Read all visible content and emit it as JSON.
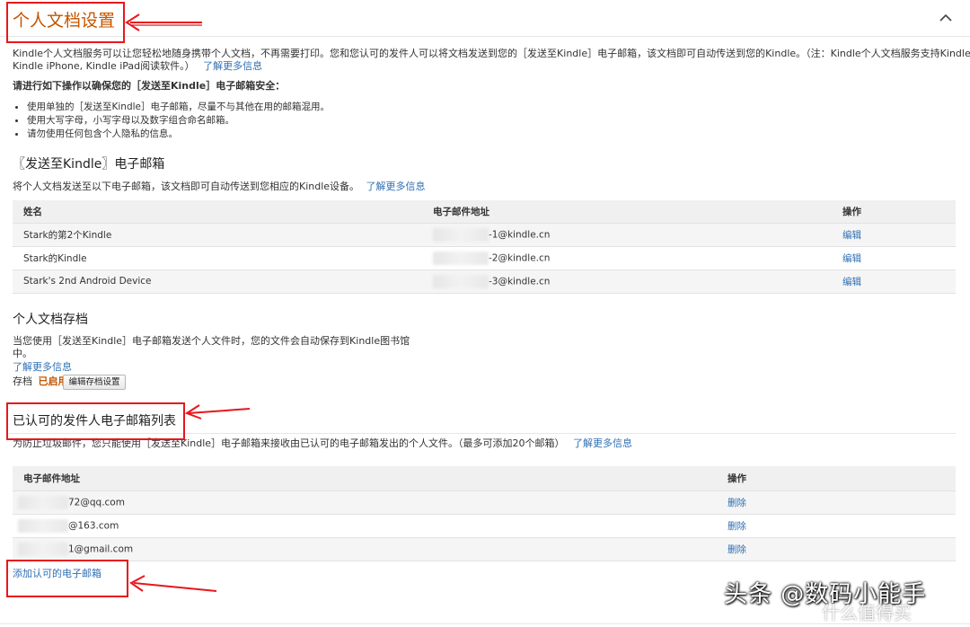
{
  "header": {
    "title": "个人文档设置",
    "collapse_icon": "chevron-up-icon"
  },
  "intro": {
    "line1": "Kindle个人文档服务可以让您轻松地随身携带个人文档，不再需要打印。您和您认可的发件人可以将文档发送到您的［发送至Kindle］电子邮箱，该文档即可自动传送到您的Kindle。（注：Kindle个人文档服务支持Kindle Android,",
    "line2": "Kindle iPhone, Kindle iPad阅读软件。）",
    "learn_more": "了解更多信息"
  },
  "security": {
    "heading": "请进行如下操作以确保您的［发送至Kindle］电子邮箱安全：",
    "tips": [
      "使用单独的［发送至Kindle］电子邮箱，尽量不与其他在用的邮箱混用。",
      "使用大写字母，小写字母以及数字组合命名邮箱。",
      "请勿使用任何包含个人隐私的信息。"
    ]
  },
  "send_to_kindle": {
    "title": "〖发送至Kindle〗电子邮箱",
    "desc": "将个人文档发送至以下电子邮箱，该文档即可自动传送到您相应的Kindle设备。",
    "learn_more": "了解更多信息",
    "columns": [
      "姓名",
      "电子邮件地址",
      "操作"
    ],
    "rows": [
      {
        "name": "Stark的第2个Kindle",
        "email": "-1@kindle.cn",
        "action": "编辑"
      },
      {
        "name": "Stark的Kindle",
        "email": "-2@kindle.cn",
        "action": "编辑"
      },
      {
        "name": "Stark's 2nd Android Device",
        "email": "-3@kindle.cn",
        "action": "编辑"
      }
    ]
  },
  "archive": {
    "title": "个人文档存档",
    "desc1": "当您使用［发送至Kindle］电子邮箱发送个人文件时，您的文件会自动保存到Kindle图书馆",
    "desc2": "中。",
    "learn_more": "了解更多信息",
    "label": "存档",
    "status": "已启用",
    "button": "编辑存档设置"
  },
  "approved": {
    "title": "已认可的发件人电子邮箱列表",
    "desc": "为防止垃圾邮件，您只能使用［发送至Kindle］电子邮箱来接收由已认可的电子邮箱发出的个人文件。（最多可添加20个邮箱）",
    "learn_more": "了解更多信息",
    "columns": [
      "电子邮件地址",
      "操作"
    ],
    "rows": [
      {
        "email": "72@qq.com",
        "action": "删除"
      },
      {
        "email": "@163.com",
        "action": "删除"
      },
      {
        "email": "1@gmail.com",
        "action": "删除"
      }
    ],
    "add_link": "添加认可的电子邮箱"
  },
  "watermark": {
    "text": "头条 @数码小能手",
    "faint": "什么值得买"
  },
  "colors": {
    "accent": "#c45500",
    "link": "#2f6fb3",
    "annotation_red": "#e8161c",
    "enabled": "#c45500"
  }
}
